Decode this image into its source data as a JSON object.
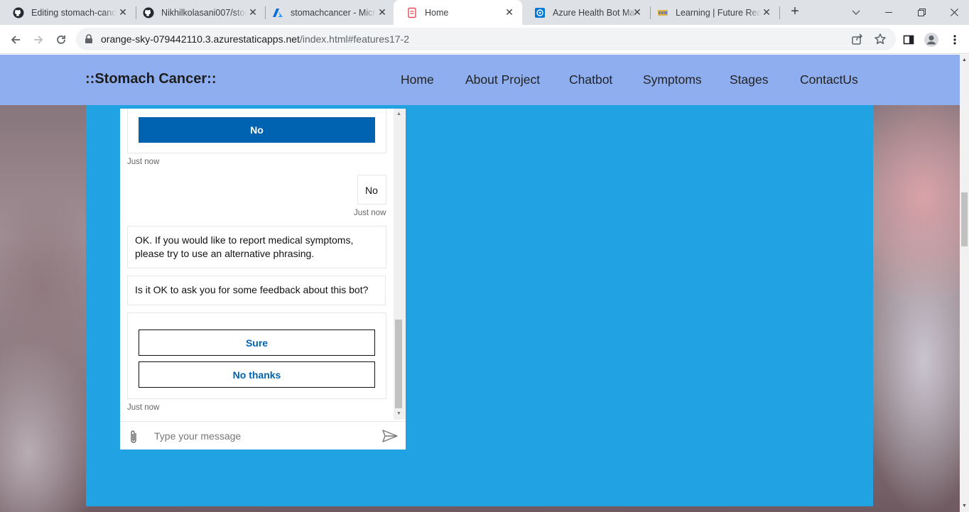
{
  "browser": {
    "tabs": [
      {
        "title": "Editing stomach-cance",
        "icon": "github-icon"
      },
      {
        "title": "Nikhilkolasani007/stor",
        "icon": "github-icon"
      },
      {
        "title": "stomachcancer - Micro",
        "icon": "azure-icon"
      },
      {
        "title": "Home",
        "icon": "page-icon"
      },
      {
        "title": "Azure Health Bot Man",
        "icon": "health-bot-icon"
      },
      {
        "title": "Learning | Future Reac",
        "icon": "learning-icon"
      }
    ],
    "active_tab": 3,
    "url_host": "orange-sky-079442110.3.azurestaticapps.net",
    "url_path": "/index.html#features17-2"
  },
  "site": {
    "brand": "::Stomach Cancer::",
    "nav": [
      "Home",
      "About Project",
      "Chatbot",
      "Symptoms",
      "Stages",
      "ContactUs"
    ]
  },
  "chat": {
    "prev_choice_button": "No",
    "timestamp_1": "Just now",
    "user_reply": "No",
    "timestamp_2": "Just now",
    "bot_message_1": "OK. If you would like to report medical symptoms, please try to use an alternative phrasing.",
    "bot_message_2": "Is it OK to ask you for some feedback about this bot?",
    "feedback_options": [
      "Sure",
      "No thanks"
    ],
    "timestamp_3": "Just now",
    "input_placeholder": "Type your message"
  },
  "colors": {
    "navbar": "#8eaef0",
    "panel": "#21a3e3",
    "primary_button": "#0063b1"
  }
}
